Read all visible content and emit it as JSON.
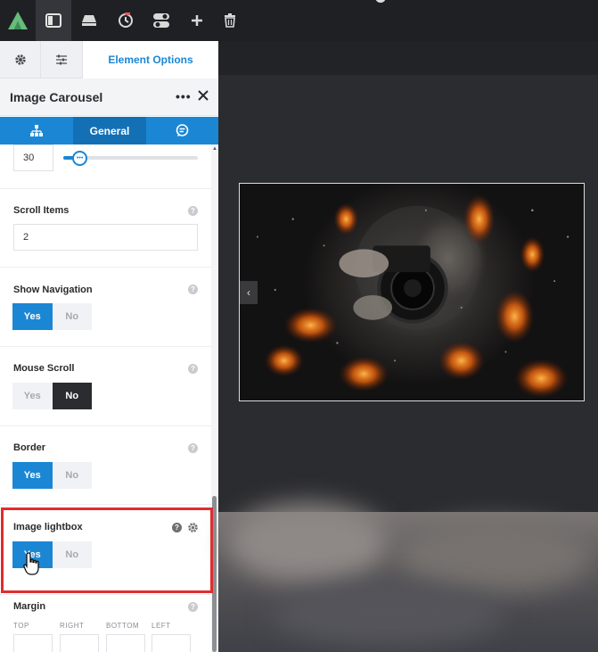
{
  "colors": {
    "accent": "#1b87d4",
    "accent_dark": "#1470b5",
    "toolbar_bg": "#1f2023",
    "highlight_border": "#e02d2d"
  },
  "toolbar": {
    "icons": [
      "avada-logo-icon",
      "sidebar-toggle-icon",
      "layout-icon",
      "history-icon",
      "toggles-icon",
      "plus-icon",
      "trash-icon"
    ]
  },
  "panel": {
    "tabs": {
      "element_options_label": "Element Options"
    },
    "header": {
      "title": "Image Carousel",
      "more_label": "•••"
    },
    "subtabs": {
      "general_label": "General"
    },
    "slider": {
      "value": "30",
      "fraction": 0.12
    },
    "scroll_items": {
      "label": "Scroll Items",
      "value": "2"
    },
    "show_navigation": {
      "label": "Show Navigation",
      "yes": "Yes",
      "no": "No",
      "selected": "Yes"
    },
    "mouse_scroll": {
      "label": "Mouse Scroll",
      "yes": "Yes",
      "no": "No",
      "selected": "No"
    },
    "border": {
      "label": "Border",
      "yes": "Yes",
      "no": "No",
      "selected": "Yes"
    },
    "image_lightbox": {
      "label": "Image lightbox",
      "yes": "Yes",
      "no": "No",
      "selected": "Yes"
    },
    "margin": {
      "label": "Margin",
      "top": "TOP",
      "right": "RIGHT",
      "bottom": "BOTTOM",
      "left": "LEFT"
    },
    "help_glyph": "?"
  },
  "canvas": {
    "prev_arrow": "‹"
  }
}
